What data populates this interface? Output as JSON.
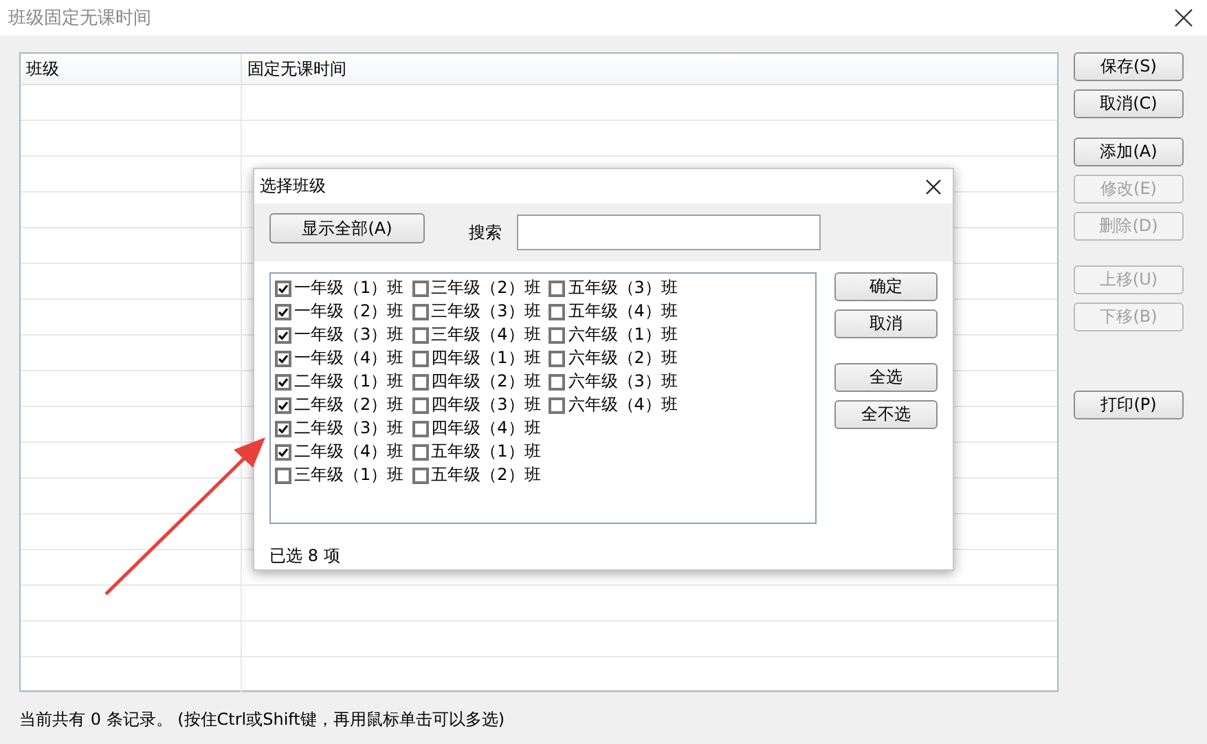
{
  "window": {
    "title": "班级固定无课时间"
  },
  "table": {
    "columns": [
      "班级",
      "固定无课时间"
    ]
  },
  "buttons": [
    {
      "label": "保存(S)",
      "disabled": false
    },
    {
      "label": "取消(C)",
      "disabled": false
    },
    {
      "label": "添加(A)",
      "disabled": false
    },
    {
      "label": "修改(E)",
      "disabled": true
    },
    {
      "label": "删除(D)",
      "disabled": true
    },
    {
      "label": "上移(U)",
      "disabled": true
    },
    {
      "label": "下移(B)",
      "disabled": true
    },
    {
      "label": "打印(P)",
      "disabled": false
    }
  ],
  "status_bar": {
    "text": "当前共有 0 条记录。 (按住Ctrl或Shift键，再用鼠标单击可以多选)"
  },
  "dialog": {
    "title": "选择班级",
    "show_all_button": "显示全部(A)",
    "search": {
      "label": "搜索"
    },
    "classes": [
      {
        "label": "一年级（1）班",
        "checked": true
      },
      {
        "label": "一年级（2）班",
        "checked": true
      },
      {
        "label": "一年级（3）班",
        "checked": true
      },
      {
        "label": "一年级（4）班",
        "checked": true
      },
      {
        "label": "二年级（1）班",
        "checked": true
      },
      {
        "label": "二年级（2）班",
        "checked": true
      },
      {
        "label": "二年级（3）班",
        "checked": true
      },
      {
        "label": "二年级（4）班",
        "checked": true
      },
      {
        "label": "三年级（1）班",
        "checked": false
      },
      {
        "label": "三年级（2）班",
        "checked": false
      },
      {
        "label": "三年级（3）班",
        "checked": false
      },
      {
        "label": "三年级（4）班",
        "checked": false
      },
      {
        "label": "四年级（1）班",
        "checked": false
      },
      {
        "label": "四年级（2）班",
        "checked": false
      },
      {
        "label": "四年级（3）班",
        "checked": false
      },
      {
        "label": "四年级（4）班",
        "checked": false
      },
      {
        "label": "五年级（1）班",
        "checked": false
      },
      {
        "label": "五年级（2）班",
        "checked": false
      },
      {
        "label": "五年级（3）班",
        "checked": false
      },
      {
        "label": "五年级（4）班",
        "checked": false
      },
      {
        "label": "六年级（1）班",
        "checked": false
      },
      {
        "label": "六年级（2）班",
        "checked": false
      },
      {
        "label": "六年级（3）班",
        "checked": false
      },
      {
        "label": "六年级（4）班",
        "checked": false
      }
    ],
    "side_buttons": [
      {
        "label": "确定"
      },
      {
        "label": "取消"
      },
      {
        "label": "全选"
      },
      {
        "label": "全不选"
      }
    ],
    "selected_count": "已选 8 项"
  }
}
